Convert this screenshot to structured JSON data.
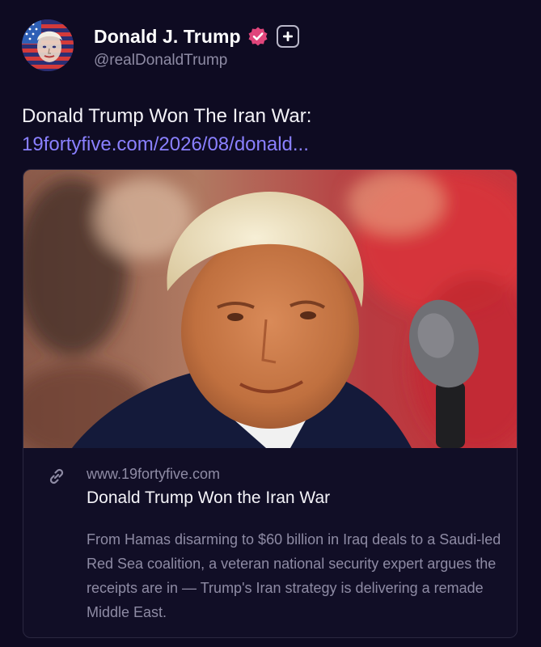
{
  "author": {
    "display_name": "Donald J. Trump",
    "handle": "@realDonaldTrump",
    "avatar_icon": "flag-portrait-avatar",
    "verified_icon": "verified-badge-icon",
    "verified_color": "#e0457b",
    "plus_icon": "plus-icon"
  },
  "post": {
    "text": "Donald Trump Won The Iran War:",
    "link_text": "19fortyfive.com/2026/08/donald...",
    "link_color": "#8a80ff"
  },
  "card": {
    "image_icon": "trump-at-microphone-photo",
    "link_icon": "link-icon",
    "domain": "www.19fortyfive.com",
    "title": "Donald Trump Won the Iran War",
    "description": "From Hamas disarming to $60 billion in Iraq deals to a Saudi-led Red Sea coalition, a veteran national security expert argues the receipts are in — Trump's Iran strategy is delivering a remade Middle East."
  },
  "colors": {
    "background": "#0e0b22",
    "text_primary": "#f4f3f8",
    "text_secondary": "#8e8ba4",
    "card_border": "#2a2740"
  }
}
